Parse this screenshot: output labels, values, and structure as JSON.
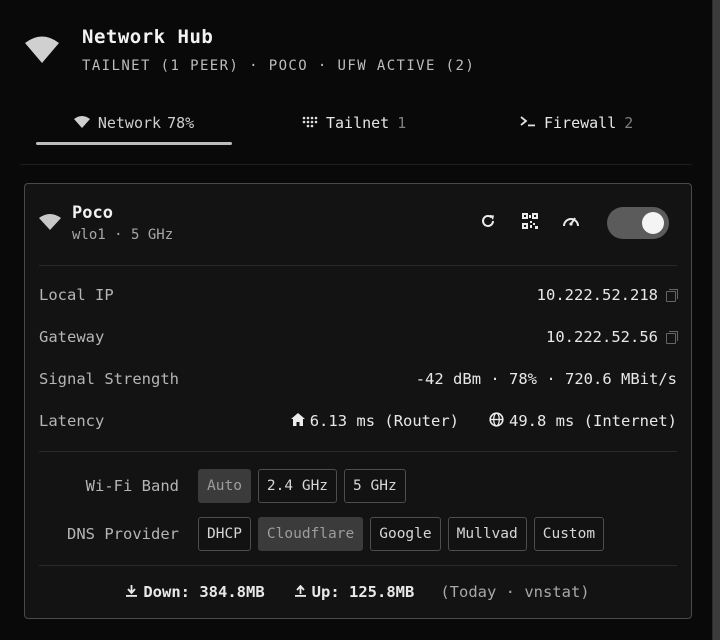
{
  "header": {
    "title": "Network Hub",
    "subtitle": "TAILNET (1 PEER) · POCO · UFW ACTIVE (2)"
  },
  "tabs": [
    {
      "label": "Network",
      "count": "78%",
      "icon": "wifi-icon",
      "active": true
    },
    {
      "label": "Tailnet",
      "count": "1",
      "icon": "grid-dots-icon",
      "active": false
    },
    {
      "label": "Firewall",
      "count": "2",
      "icon": "terminal-prompt-icon",
      "active": false
    }
  ],
  "card": {
    "title": "Poco",
    "subtitle": "wlo1 · 5 GHz",
    "toggle_on": true,
    "rows": [
      {
        "label": "Local IP",
        "value": "10.222.52.218",
        "copy": true
      },
      {
        "label": "Gateway",
        "value": "10.222.52.56",
        "copy": true
      },
      {
        "label": "Signal Strength",
        "value": "-42 dBm · 78% · 720.6 MBit/s",
        "copy": false
      }
    ],
    "latency": {
      "label": "Latency",
      "router": "6.13 ms (Router)",
      "internet": "49.8 ms (Internet)"
    },
    "wifi_band": {
      "label": "Wi-Fi Band",
      "options": [
        "Auto",
        "2.4 GHz",
        "5 GHz"
      ],
      "selected": "Auto"
    },
    "dns": {
      "label": "DNS Provider",
      "options": [
        "DHCP",
        "Cloudflare",
        "Google",
        "Mullvad",
        "Custom"
      ],
      "selected": "Cloudflare"
    },
    "usage": {
      "down": "Down: 384.8MB",
      "up": "Up: 125.8MB",
      "note": "(Today · vnstat)"
    }
  },
  "colors": {
    "background": "#090909",
    "card": "#131313",
    "selected_button": "#3b3b3b",
    "text": "#e8e8e8"
  }
}
